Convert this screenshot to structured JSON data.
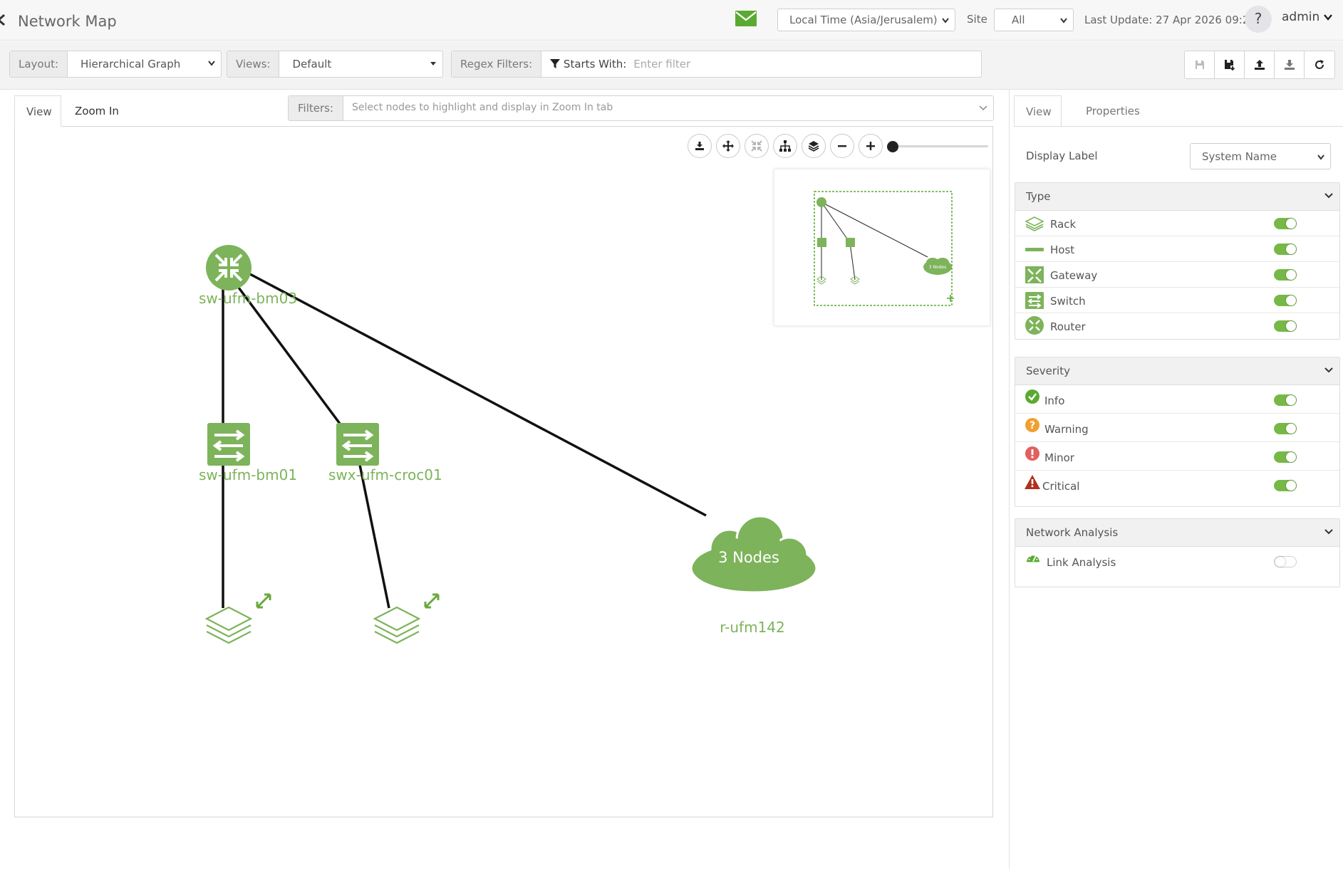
{
  "header": {
    "title": "Network Map",
    "timezone": "Local Time (Asia/Jerusalem)",
    "site_label": "Site",
    "site_value": "All",
    "last_update": "Last Update: 27 Apr 2026 09:20",
    "help": "?",
    "user": "admin"
  },
  "toolbar": {
    "layout_label": "Layout:",
    "layout_value": "Hierarchical Graph",
    "views_label": "Views:",
    "views_value": "Default",
    "regex_label": "Regex Filters:",
    "starts_with": "Starts With:",
    "regex_placeholder": "Enter filter",
    "icons": [
      "save-icon",
      "save-as-icon",
      "upload-icon",
      "download-icon",
      "refresh-icon"
    ]
  },
  "main": {
    "tabs": [
      {
        "label": "View",
        "active": true
      },
      {
        "label": "Zoom In",
        "active": false
      }
    ],
    "filters_label": "Filters:",
    "filters_placeholder": "Select nodes to highlight and display in Zoom In tab",
    "zoom_level": 0
  },
  "graph": {
    "nodes": [
      {
        "id": "sw-ufm-bm03",
        "label": "sw-ufm-bm03",
        "type": "router"
      },
      {
        "id": "sw-ufm-bm01",
        "label": "sw-ufm-bm01",
        "type": "switch"
      },
      {
        "id": "swx-ufm-croc01",
        "label": "swx-ufm-croc01",
        "type": "switch"
      },
      {
        "id": "rack-1",
        "label": "",
        "type": "rack"
      },
      {
        "id": "rack-2",
        "label": "",
        "type": "rack"
      },
      {
        "id": "r-ufm142",
        "label": "r-ufm142",
        "type": "group",
        "group_text": "3 Nodes"
      }
    ],
    "links": [
      [
        "sw-ufm-bm03",
        "sw-ufm-bm01"
      ],
      [
        "sw-ufm-bm03",
        "swx-ufm-croc01"
      ],
      [
        "sw-ufm-bm03",
        "r-ufm142"
      ],
      [
        "sw-ufm-bm01",
        "rack-1"
      ],
      [
        "swx-ufm-croc01",
        "rack-2"
      ]
    ],
    "minimap_group_text": "3 Nodes"
  },
  "right_panel": {
    "tabs": [
      {
        "label": "View",
        "active": true
      },
      {
        "label": "Properties",
        "active": false
      }
    ],
    "display_label": "Display Label",
    "display_value": "System Name",
    "type_section": {
      "title": "Type",
      "items": [
        {
          "label": "Rack",
          "icon": "rack-icon",
          "on": true
        },
        {
          "label": "Host",
          "icon": "host-icon",
          "on": true
        },
        {
          "label": "Gateway",
          "icon": "gateway-icon",
          "on": true
        },
        {
          "label": "Switch",
          "icon": "switch-icon",
          "on": true
        },
        {
          "label": "Router",
          "icon": "router-icon",
          "on": true
        }
      ]
    },
    "severity_section": {
      "title": "Severity",
      "items": [
        {
          "label": "Info",
          "icon": "info-check-icon",
          "on": true,
          "color": "#76b947"
        },
        {
          "label": "Warning",
          "icon": "warning-question-icon",
          "on": true,
          "color": "#f0a030"
        },
        {
          "label": "Minor",
          "icon": "minor-exclamation-icon",
          "on": true,
          "color": "#e06060"
        },
        {
          "label": "Critical",
          "icon": "critical-triangle-icon",
          "on": true,
          "color": "#b03020"
        }
      ]
    },
    "analysis_section": {
      "title": "Network Analysis",
      "items": [
        {
          "label": "Link Analysis",
          "icon": "gauge-icon",
          "on": false
        }
      ]
    }
  },
  "colors": {
    "accent": "#76b947",
    "node_green": "#7db35a",
    "link": "#111111"
  }
}
